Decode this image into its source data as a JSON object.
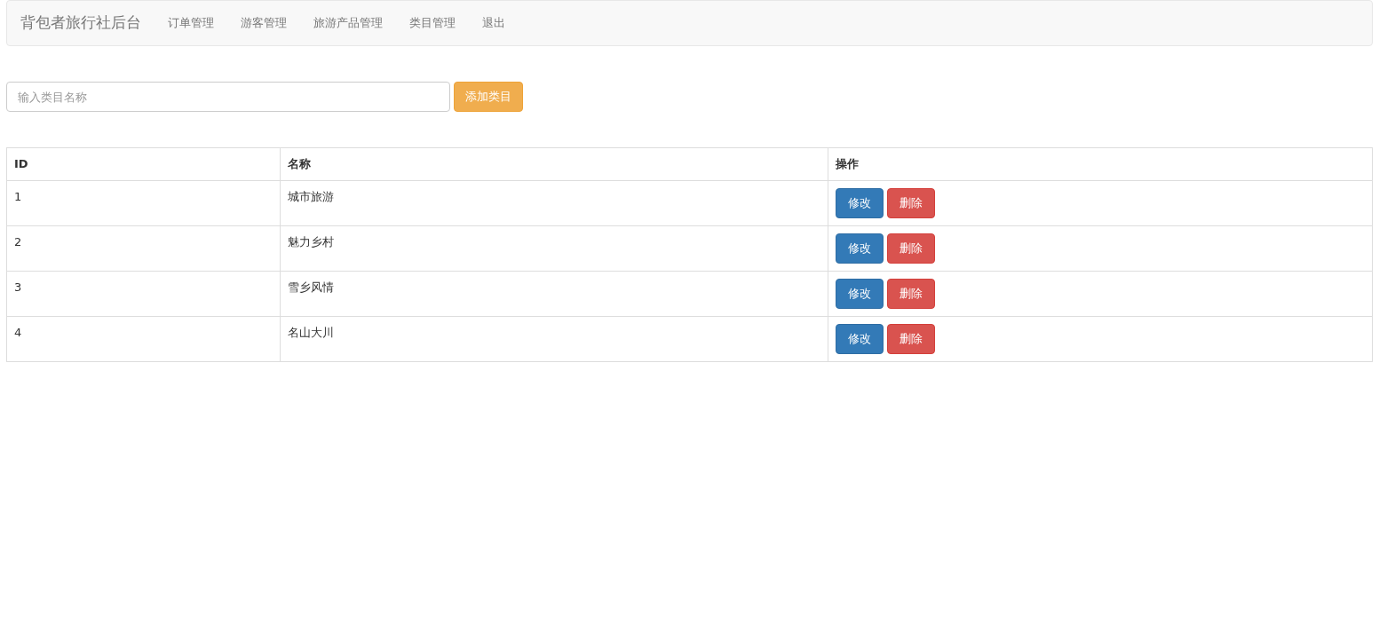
{
  "navbar": {
    "brand": "背包者旅行社后台",
    "items": [
      "订单管理",
      "游客管理",
      "旅游产品管理",
      "类目管理",
      "退出"
    ]
  },
  "add_form": {
    "placeholder": "输入类目名称",
    "button": "添加类目"
  },
  "table": {
    "columns": [
      "ID",
      "名称",
      "操作"
    ],
    "rows": [
      {
        "id": "1",
        "name": "城市旅游",
        "actions": [
          "修改",
          "删除"
        ]
      },
      {
        "id": "2",
        "name": "魅力乡村",
        "actions": [
          "修改",
          "删除"
        ]
      },
      {
        "id": "3",
        "name": "雪乡风情",
        "actions": [
          "修改",
          "删除"
        ]
      },
      {
        "id": "4",
        "name": "名山大川",
        "actions": [
          "修改",
          "删除"
        ]
      }
    ]
  }
}
